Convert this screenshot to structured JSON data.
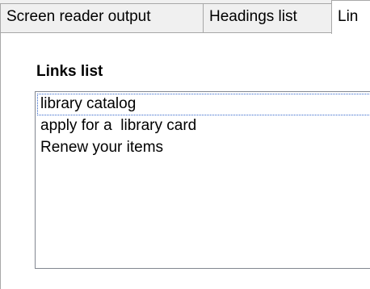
{
  "tabs": [
    {
      "label": "Screen reader output"
    },
    {
      "label": "Headings list"
    },
    {
      "label": "Lin"
    }
  ],
  "links_panel": {
    "title": "Links list",
    "items": [
      {
        "label": "library catalog",
        "selected": true
      },
      {
        "label": "apply for a  library card"
      },
      {
        "label": "Renew your items"
      }
    ]
  },
  "colors": {
    "tab_border": "#a8a8a8",
    "tab_background": "#f0f0f0",
    "focus_outline": "#3366cc"
  }
}
